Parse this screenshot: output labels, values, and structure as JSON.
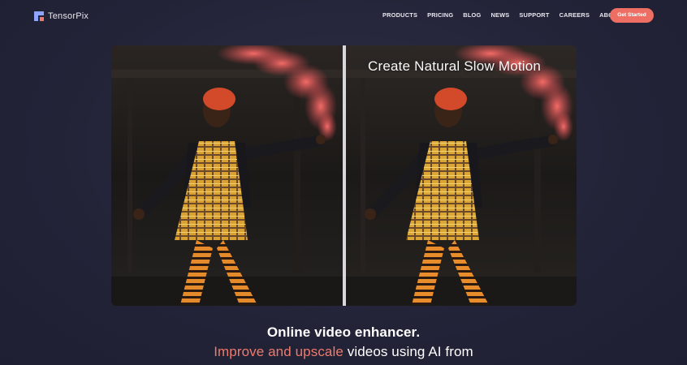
{
  "brand": {
    "name": "TensorPix"
  },
  "nav": {
    "items": [
      "PRODUCTS",
      "PRICING",
      "BLOG",
      "NEWS",
      "SUPPORT",
      "CAREERS",
      "ABOUT"
    ],
    "cta": "Get Started"
  },
  "hero": {
    "caption": "Create Natural Slow Motion",
    "headline": "Online video enhancer.",
    "sub_accent": "Improve and upscale",
    "sub_rest": " videos using AI from"
  },
  "colors": {
    "accent": "#ef6e63",
    "background": "#25253a",
    "logo_blue": "#8ea2ff"
  }
}
